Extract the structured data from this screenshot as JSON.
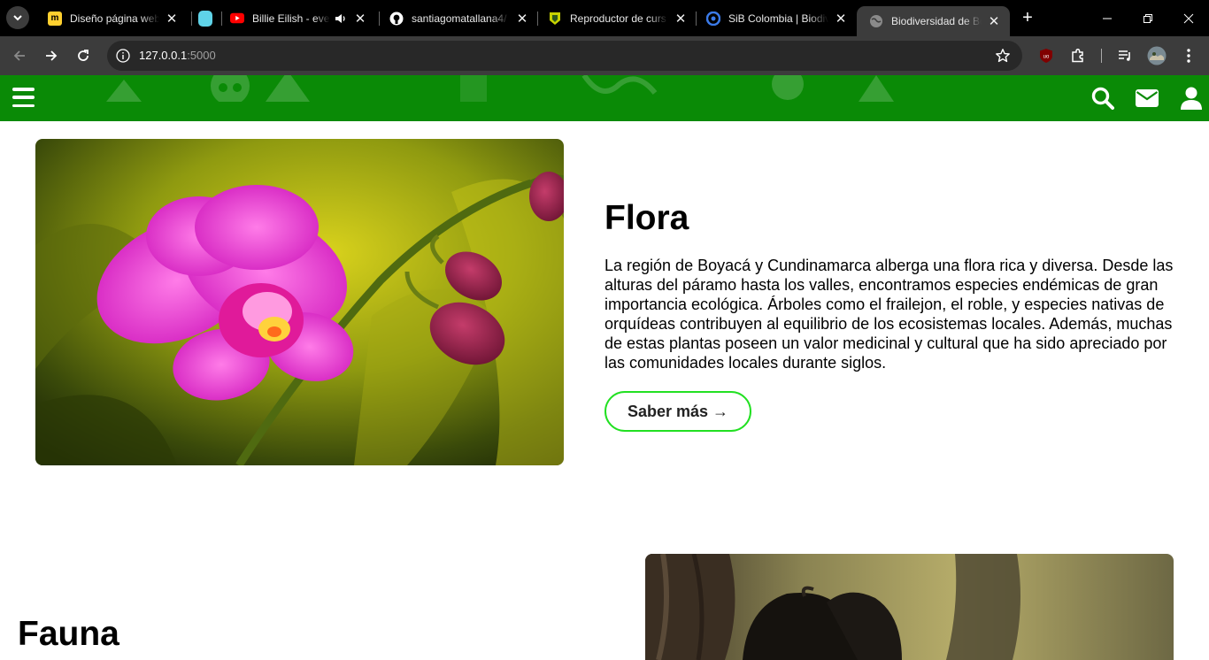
{
  "browser": {
    "tabs": [
      {
        "title": "Diseño página web",
        "favicon": "miro-icon",
        "color": "#ffd02f"
      },
      {
        "title": "",
        "favicon": "app-icon",
        "color": "#5fd3e8"
      },
      {
        "title": "Billie Eilish - every",
        "favicon": "youtube-icon",
        "color": "#ff0000"
      },
      {
        "title": "santiagomatallana4/",
        "favicon": "github-icon",
        "color": "#ffffff"
      },
      {
        "title": "Reproductor de curs",
        "favicon": "course-icon",
        "color": "#c7d300"
      },
      {
        "title": "SiB Colombia | Biodiv",
        "favicon": "sib-icon",
        "color": "#2f6fdb"
      },
      {
        "title": "Biodiversidad de Boy",
        "favicon": "globe-icon",
        "color": "#9a9a9a"
      }
    ],
    "url_host": "127.0.0.1",
    "url_port": ":5000"
  },
  "flora": {
    "title": "Flora",
    "description": "La región de Boyacá y Cundinamarca alberga una flora rica y diversa. Desde las alturas del páramo hasta los valles, encontramos especies endémicas de gran importancia ecológica. Árboles como el frailejon, el roble, y especies nativas de orquídeas contribuyen al equilibrio de los ecosistemas locales. Además, muchas de estas plantas poseen un valor medicinal y cultural que ha sido apreciado por las comunidades locales durante siglos.",
    "button_label": "Saber más →"
  },
  "fauna": {
    "title": "Fauna"
  },
  "colors": {
    "header_green": "#0a8a06",
    "button_border": "#22e022"
  }
}
